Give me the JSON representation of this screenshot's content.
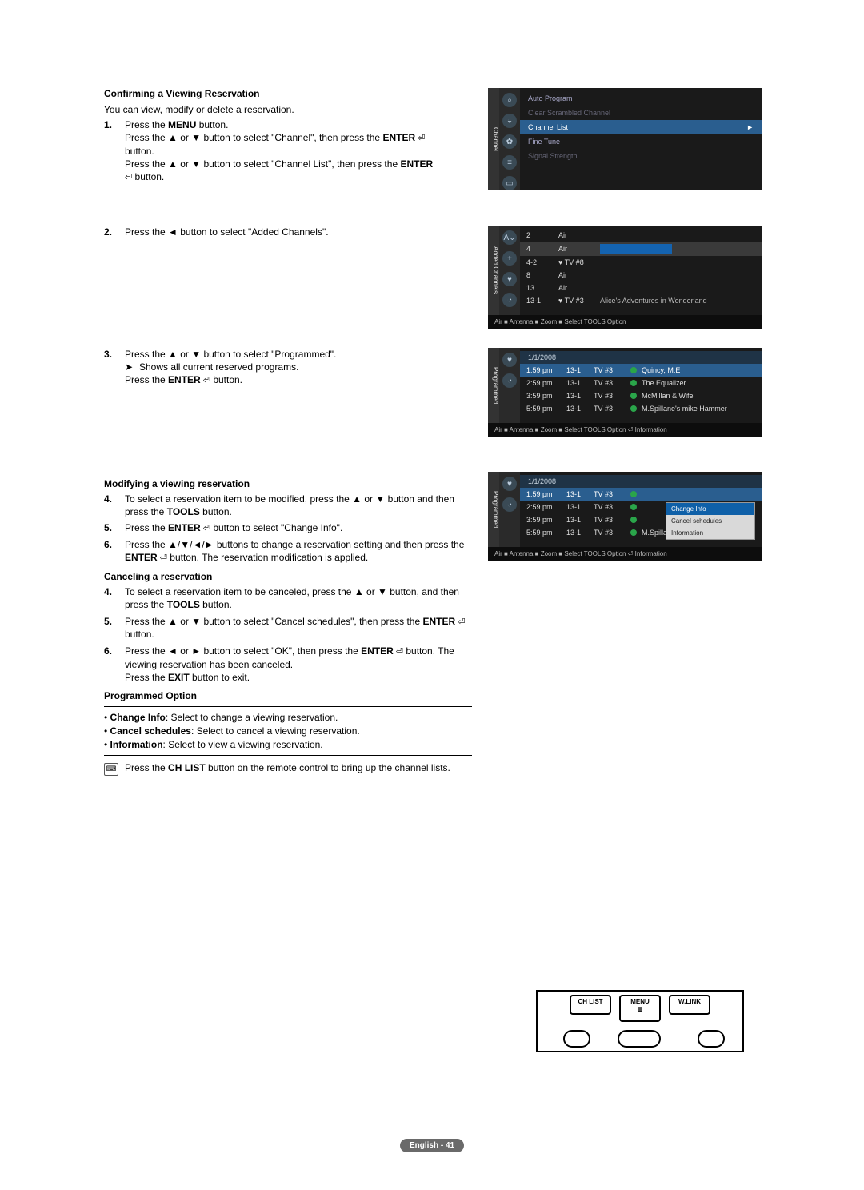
{
  "section1": {
    "title": "Confirming a Viewing Reservation",
    "intro": "You can view, modify or delete a reservation.",
    "step1": {
      "n": "1.",
      "l1a": "Press the ",
      "l1b": "MENU",
      "l1c": " button.",
      "l2": "Press the ▲ or ▼ button to select \"Channel\", then press the ",
      "l2b": "ENTER",
      "l2c": " button.",
      "l3": "Press the ▲ or ▼ button to select \"Channel List\", then press the ",
      "l3b": "ENTER",
      "l3c": " button."
    },
    "step2": {
      "n": "2.",
      "t": "Press the ◄ button to select \"Added Channels\"."
    },
    "step3": {
      "n": "3.",
      "l1": "Press the ▲ or ▼ button to select \"Programmed\".",
      "sub": "Shows all current reserved programs.",
      "l2": "Press the ",
      "l2b": "ENTER",
      "l2c": " button."
    }
  },
  "modify": {
    "title": "Modifying a viewing reservation",
    "s4": {
      "n": "4.",
      "t": "To select a reservation item to be modified, press the ▲ or ▼ button and then press the ",
      "b": "TOOLS",
      "t2": " button."
    },
    "s5": {
      "n": "5.",
      "t": "Press the ",
      "b": "ENTER",
      "t2": " button to select \"Change Info\"."
    },
    "s6": {
      "n": "6.",
      "t": "Press the ▲/▼/◄/► buttons to change a reservation setting and then press the ",
      "b": "ENTER",
      "t2": " button. The reservation modification is applied."
    }
  },
  "cancel": {
    "title": "Canceling a reservation",
    "s4": {
      "n": "4.",
      "t": "To select a reservation item to be canceled, press the ▲ or ▼ button, and then press the ",
      "b": "TOOLS",
      "t2": " button."
    },
    "s5": {
      "n": "5.",
      "t": "Press the ▲ or ▼ button to select \"Cancel schedules\", then press the ",
      "b": "ENTER",
      "t2": " button."
    },
    "s6": {
      "n": "6.",
      "t": "Press the ◄ or ► button to select \"OK\", then press the ",
      "b": "ENTER",
      "t2": " button. The viewing reservation has been canceled.",
      "exit": "Press the ",
      "exitb": "EXIT",
      "exitc": " button to exit."
    }
  },
  "prog_option": {
    "title": "Programmed Option",
    "items": [
      {
        "b": "Change Info",
        "t": ": Select to change a viewing reservation."
      },
      {
        "b": "Cancel schedules",
        "t": ": Select to cancel a viewing reservation."
      },
      {
        "b": "Information",
        "t": ": Select to view a viewing reservation."
      }
    ]
  },
  "chlist_note": {
    "t1": "Press the ",
    "b": "CH LIST",
    "t2": " button on the remote control to bring up the channel lists."
  },
  "shot1": {
    "tab": "Channel",
    "items": [
      {
        "label": "Auto Program",
        "state": ""
      },
      {
        "label": "Clear Scrambled Channel",
        "state": "dim"
      },
      {
        "label": "Channel List",
        "state": "sel"
      },
      {
        "label": "Fine Tune",
        "state": ""
      },
      {
        "label": "Signal Strength",
        "state": "dim"
      }
    ],
    "arrow": "►"
  },
  "shot2": {
    "tab": "Added Channels",
    "rows": [
      {
        "num": "2",
        "src": "Air",
        "name": ""
      },
      {
        "num": "4",
        "src": "Air",
        "name": "",
        "sel": true
      },
      {
        "num": "4-2",
        "src": "♥ TV #8",
        "name": ""
      },
      {
        "num": "8",
        "src": "Air",
        "name": ""
      },
      {
        "num": "13",
        "src": "Air",
        "name": ""
      },
      {
        "num": "13-1",
        "src": "♥ TV #3",
        "name": "Alice's Adventures in Wonderland"
      }
    ],
    "footer": "Air ■ Antenna    ■ Zoom    ■ Select    TOOLS Option"
  },
  "shot3": {
    "tab": "Programmed",
    "date": "1/1/2008",
    "rows": [
      {
        "time": "1:59 pm",
        "ch": "13-1",
        "tv": "TV #3",
        "title": "Quincy, M.E",
        "sel": true
      },
      {
        "time": "2:59 pm",
        "ch": "13-1",
        "tv": "TV #3",
        "title": "The Equalizer"
      },
      {
        "time": "3:59 pm",
        "ch": "13-1",
        "tv": "TV #3",
        "title": "McMillan & Wife"
      },
      {
        "time": "5:59 pm",
        "ch": "13-1",
        "tv": "TV #3",
        "title": "M.Spillane's mike Hammer"
      }
    ],
    "footer": "Air ■ Antenna  ■ Zoom  ■ Select  TOOLS Option ⏎ Information"
  },
  "shot4": {
    "tab": "Programmed",
    "date": "1/1/2008",
    "rows": [
      {
        "time": "1:59 pm",
        "ch": "13-1",
        "tv": "TV #3",
        "sel": true
      },
      {
        "time": "2:59 pm",
        "ch": "13-1",
        "tv": "TV #3"
      },
      {
        "time": "3:59 pm",
        "ch": "13-1",
        "tv": "TV #3"
      },
      {
        "time": "5:59 pm",
        "ch": "13-1",
        "tv": "TV #3",
        "title": "M.Spillane's mike Hammer"
      }
    ],
    "popup": [
      {
        "label": "Change Info",
        "sel": true
      },
      {
        "label": "Cancel schedules"
      },
      {
        "label": "Information"
      }
    ],
    "footer": "Air ■ Antenna  ■ Zoom  ■ Select  TOOLS Option ⏎ Information"
  },
  "remote": {
    "b1": "CH LIST",
    "b2": "MENU",
    "b3": "W.LINK"
  },
  "page_label": "English - 41"
}
